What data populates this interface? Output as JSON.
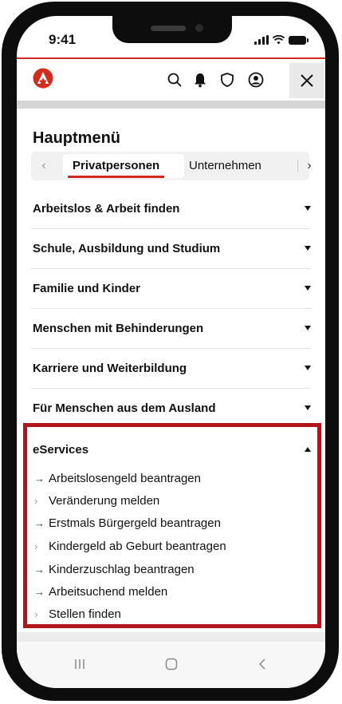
{
  "status_bar": {
    "time": "9:41"
  },
  "header": {
    "logo_icon": "agentur-logo",
    "icons": [
      "search-icon",
      "bell-icon",
      "shield-icon",
      "account-icon",
      "close-icon"
    ],
    "brand_color": "#d32b1e"
  },
  "menu": {
    "title": "Hauptmenü",
    "tabs": [
      {
        "label": "Privatpersonen",
        "active": true
      },
      {
        "label": "Unternehmen",
        "active": false
      }
    ],
    "items": [
      {
        "label": "Arbeitslos & Arbeit finden",
        "expanded": false
      },
      {
        "label": "Schule, Ausbildung und Studium",
        "expanded": false
      },
      {
        "label": "Familie und Kinder",
        "expanded": false
      },
      {
        "label": "Menschen mit Behinderungen",
        "expanded": false
      },
      {
        "label": "Karriere und Weiterbildung",
        "expanded": false
      },
      {
        "label": "Für Menschen aus dem Ausland",
        "expanded": false
      },
      {
        "label": "eServices",
        "expanded": true
      }
    ],
    "eservices": [
      {
        "label": "Arbeitslosengeld beantragen",
        "icon": "arrow-right-icon"
      },
      {
        "label": "Veränderung melden",
        "icon": "chevron-right-icon"
      },
      {
        "label": "Erstmals Bürgergeld beantragen",
        "icon": "arrow-right-icon"
      },
      {
        "label": "Kindergeld ab Geburt beantragen",
        "icon": "chevron-right-icon"
      },
      {
        "label": "Kinderzuschlag beantragen",
        "icon": "arrow-right-icon"
      },
      {
        "label": "Arbeitsuchend melden",
        "icon": "arrow-right-icon"
      },
      {
        "label": "Stellen finden",
        "icon": "chevron-right-icon"
      }
    ],
    "highlight_color": "#b3131b"
  },
  "system_nav": [
    "recents-icon",
    "home-icon",
    "back-icon"
  ]
}
